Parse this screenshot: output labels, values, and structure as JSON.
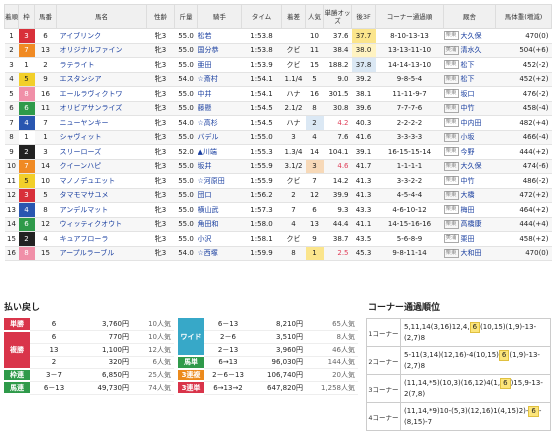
{
  "results": {
    "headers": [
      "着順",
      "枠",
      "馬番",
      "馬名",
      "性齢",
      "斤量",
      "騎手",
      "タイム",
      "着差",
      "人気",
      "単勝オッズ",
      "後3F",
      "コーナー通過順",
      "厩舎",
      "馬体重(増減)"
    ],
    "frame_colors": {
      "1": "#ffffff",
      "2": "#222222",
      "3": "#d8303a",
      "4": "#2956b0",
      "5": "#f2cf2a",
      "6": "#2f9a4a",
      "7": "#f08a24",
      "8": "#f08fa8"
    },
    "rows": [
      {
        "rank": "1",
        "waku": "3",
        "num": "6",
        "name": "アイブリンク",
        "sa": "牝3",
        "kin": "55.0",
        "jockey": "松若",
        "time": "1:53.8",
        "diff": "",
        "pop": "10",
        "odds": "37.6",
        "last": "37.7",
        "corner": "8-10-13-13",
        "region": "栗東",
        "trainer": "大久保",
        "weight": "470(0)"
      },
      {
        "rank": "2",
        "waku": "7",
        "num": "13",
        "name": "オリジナルファイン",
        "sa": "牝3",
        "kin": "55.0",
        "jockey": "国分恭",
        "time": "1:53.8",
        "diff": "クビ",
        "pop": "11",
        "odds": "38.4",
        "last": "38.0",
        "corner": "13-13-11-10",
        "region": "美浦",
        "trainer": "清水久",
        "weight": "504(+6)"
      },
      {
        "rank": "3",
        "waku": "1",
        "num": "2",
        "name": "ラテライト",
        "sa": "牝3",
        "kin": "55.0",
        "jockey": "亜田",
        "time": "1:53.9",
        "diff": "クビ",
        "pop": "15",
        "odds": "188.2",
        "last": "37.8",
        "corner": "14-14-13-10",
        "region": "栗東",
        "trainer": "松下",
        "weight": "452(-2)"
      },
      {
        "rank": "4",
        "waku": "5",
        "num": "9",
        "name": "エスタンシア",
        "sa": "牝3",
        "kin": "54.0",
        "jockey": "☆斎村",
        "time": "1:54.1",
        "diff": "1.1/4",
        "pop": "5",
        "odds": "9.0",
        "last": "39.2",
        "corner": "9-8-5-4",
        "region": "栗東",
        "trainer": "松下",
        "weight": "452(+2)"
      },
      {
        "rank": "5",
        "waku": "8",
        "num": "16",
        "name": "エールラヴィクトワ",
        "sa": "牝3",
        "kin": "55.0",
        "jockey": "中井",
        "time": "1:54.1",
        "diff": "ハナ",
        "pop": "16",
        "odds": "301.5",
        "last": "38.1",
        "corner": "11-11-9-7",
        "region": "栗東",
        "trainer": "坂口",
        "weight": "476(-2)"
      },
      {
        "rank": "6",
        "waku": "6",
        "num": "11",
        "name": "オリビアサンライズ",
        "sa": "牝3",
        "kin": "55.0",
        "jockey": "藤懸",
        "time": "1:54.5",
        "diff": "2.1/2",
        "pop": "8",
        "odds": "30.8",
        "last": "39.6",
        "corner": "7-7-7-6",
        "region": "栗東",
        "trainer": "中竹",
        "weight": "458(-4)"
      },
      {
        "rank": "7",
        "waku": "4",
        "num": "7",
        "name": "ニューヤンキー",
        "sa": "牝3",
        "kin": "54.0",
        "jockey": "☆高杉",
        "time": "1:54.5",
        "diff": "ハナ",
        "pop": "2",
        "odds": "4.2",
        "last": "40.3",
        "corner": "2-2-2-2",
        "region": "栗東",
        "trainer": "中内田",
        "weight": "482(+4)"
      },
      {
        "rank": "8",
        "waku": "1",
        "num": "1",
        "name": "シャヴィット",
        "sa": "牝3",
        "kin": "55.0",
        "jockey": "バデル",
        "time": "1:55.0",
        "diff": "3",
        "pop": "4",
        "odds": "7.6",
        "last": "41.6",
        "corner": "3-3-3-3",
        "region": "栗東",
        "trainer": "小坂",
        "weight": "466(-4)"
      },
      {
        "rank": "9",
        "waku": "2",
        "num": "3",
        "name": "スリーローズ",
        "sa": "牝3",
        "kin": "52.0",
        "jockey": "▲川端",
        "time": "1:55.3",
        "diff": "1.3/4",
        "pop": "14",
        "odds": "104.1",
        "last": "39.1",
        "corner": "16-15-15-14",
        "region": "栗東",
        "trainer": "今野",
        "weight": "444(+2)"
      },
      {
        "rank": "10",
        "waku": "7",
        "num": "14",
        "name": "クイーンハピ",
        "sa": "牝3",
        "kin": "55.0",
        "jockey": "坂井",
        "time": "1:55.9",
        "diff": "3.1/2",
        "pop": "3",
        "odds": "4.6",
        "last": "41.7",
        "corner": "1-1-1-1",
        "region": "栗東",
        "trainer": "大久保",
        "weight": "474(-6)"
      },
      {
        "rank": "11",
        "waku": "5",
        "num": "10",
        "name": "マノノデュエット",
        "sa": "牝3",
        "kin": "55.0",
        "jockey": "☆河原田",
        "time": "1:55.9",
        "diff": "クビ",
        "pop": "7",
        "odds": "14.2",
        "last": "41.3",
        "corner": "3-3-2-2",
        "region": "栗東",
        "trainer": "中竹",
        "weight": "486(-2)"
      },
      {
        "rank": "12",
        "waku": "3",
        "num": "5",
        "name": "タマモマサユメ",
        "sa": "牝3",
        "kin": "55.0",
        "jockey": "団口",
        "time": "1:56.2",
        "diff": "2",
        "pop": "12",
        "odds": "39.9",
        "last": "41.3",
        "corner": "4-5-4-4",
        "region": "栗東",
        "trainer": "大橋",
        "weight": "472(+2)"
      },
      {
        "rank": "13",
        "waku": "4",
        "num": "8",
        "name": "アンデルマット",
        "sa": "牝3",
        "kin": "55.0",
        "jockey": "横山武",
        "time": "1:57.3",
        "diff": "7",
        "pop": "6",
        "odds": "9.3",
        "last": "43.3",
        "corner": "4-6-10-12",
        "region": "栗東",
        "trainer": "梅田",
        "weight": "464(+2)"
      },
      {
        "rank": "14",
        "waku": "6",
        "num": "12",
        "name": "ウィッティクオウト",
        "sa": "牝3",
        "kin": "55.0",
        "jockey": "角田和",
        "time": "1:58.0",
        "diff": "4",
        "pop": "13",
        "odds": "44.4",
        "last": "41.1",
        "corner": "14-15-16-16",
        "region": "栗東",
        "trainer": "高橋康",
        "weight": "444(+4)"
      },
      {
        "rank": "15",
        "waku": "2",
        "num": "4",
        "name": "キュアフローラ",
        "sa": "牝3",
        "kin": "55.0",
        "jockey": "小沢",
        "time": "1:58.1",
        "diff": "クビ",
        "pop": "9",
        "odds": "38.7",
        "last": "43.5",
        "corner": "5-6-8-9",
        "region": "美浦",
        "trainer": "栗田",
        "weight": "458(+2)"
      },
      {
        "rank": "16",
        "waku": "8",
        "num": "15",
        "name": "アープルラーブル",
        "sa": "牝3",
        "kin": "54.0",
        "jockey": "☆西塚",
        "time": "1:59.9",
        "diff": "8",
        "pop": "1",
        "odds": "2.5",
        "last": "45.3",
        "corner": "9-8-11-14",
        "region": "栗東",
        "trainer": "大和田",
        "weight": "470(0)"
      }
    ]
  },
  "payout": {
    "title": "払い戻し",
    "left": [
      {
        "label": "単勝",
        "color": "#d9344a",
        "rows": [
          {
            "num": "6",
            "yen": "3,760円",
            "pop": "10人気"
          }
        ]
      },
      {
        "label": "複勝",
        "color": "#d9344a",
        "rows": [
          {
            "num": "6",
            "yen": "770円",
            "pop": "10人気"
          },
          {
            "num": "13",
            "yen": "1,100円",
            "pop": "12人気"
          },
          {
            "num": "2",
            "yen": "320円",
            "pop": "6人気"
          }
        ]
      },
      {
        "label": "枠連",
        "color": "#2f9a4a",
        "rows": [
          {
            "num": "3－7",
            "yen": "6,850円",
            "pop": "25人気"
          }
        ]
      },
      {
        "label": "馬連",
        "color": "#2f9a4a",
        "rows": [
          {
            "num": "6－13",
            "yen": "49,730円",
            "pop": "74人気"
          }
        ]
      }
    ],
    "right": [
      {
        "label": "ワイド",
        "color": "#37a8c8",
        "rows": [
          {
            "num": "6－13",
            "yen": "8,210円",
            "pop": "65人気"
          },
          {
            "num": "2－6",
            "yen": "3,510円",
            "pop": "8人気"
          },
          {
            "num": "2－13",
            "yen": "3,960円",
            "pop": "46人気"
          }
        ]
      },
      {
        "label": "馬単",
        "color": "#2f9a4a",
        "rows": [
          {
            "num": "6→13",
            "yen": "96,030円",
            "pop": "144人気"
          }
        ]
      },
      {
        "label": "3連複",
        "color": "#ec8a1c",
        "rows": [
          {
            "num": "2－6－13",
            "yen": "106,740円",
            "pop": "20人気"
          }
        ]
      },
      {
        "label": "3連単",
        "color": "#d9344a",
        "rows": [
          {
            "num": "6→13→2",
            "yen": "647,820円",
            "pop": "1,258人気"
          }
        ]
      }
    ]
  },
  "corner": {
    "title": "コーナー通過順位",
    "rows": [
      {
        "label": "1コーナー",
        "pre": "5,11,14(3,16)12,4,",
        "box": "6",
        "post": "(10,15)(1,9)-13-(2,7)8"
      },
      {
        "label": "2コーナー",
        "pre": "5-11(3,14)(12,16)-4(10,15)",
        "box": "6",
        "post": "(1,9)-13-(2,7)8"
      },
      {
        "label": "3コーナー",
        "pre": "(11,14,*5)(10,3)(16,12)4(1,",
        "box": "6",
        "post": ")15,9-13-2(7,8)"
      },
      {
        "label": "4コーナー",
        "pre": "(11,14,*9)10-(5,3)(12,16)1(4,15)2)-",
        "box": "6",
        "post": "-(8,15)-7"
      }
    ]
  }
}
